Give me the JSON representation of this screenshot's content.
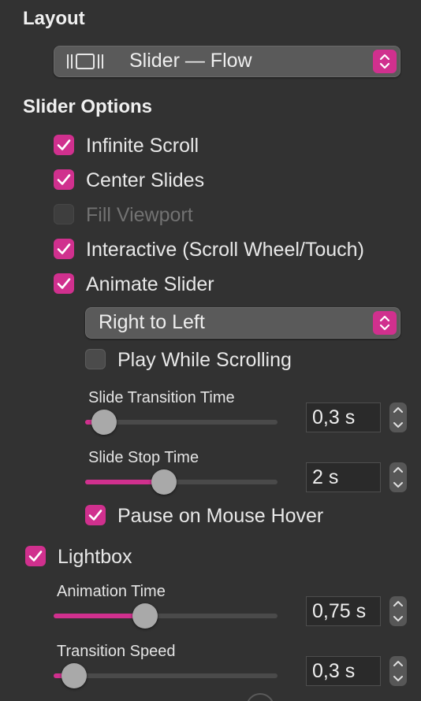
{
  "layout": {
    "title": "Layout",
    "select_value": "Slider — Flow",
    "select_icon": "slider-flow-icon"
  },
  "slider_options": {
    "title": "Slider Options",
    "infinite_scroll": {
      "label": "Infinite Scroll",
      "checked": true
    },
    "center_slides": {
      "label": "Center Slides",
      "checked": true
    },
    "fill_viewport": {
      "label": "Fill Viewport",
      "checked": false,
      "enabled": false
    },
    "interactive": {
      "label": "Interactive (Scroll Wheel/Touch)",
      "checked": true
    },
    "animate_slider": {
      "label": "Animate Slider",
      "checked": true
    },
    "direction_select": "Right to Left",
    "play_while_scrolling": {
      "label": "Play While Scrolling",
      "checked": false
    },
    "slide_transition_time": {
      "label": "Slide Transition Time",
      "value": "0,3 s",
      "level": 0.1
    },
    "slide_stop_time": {
      "label": "Slide Stop Time",
      "value": "2 s",
      "level": 0.41
    },
    "pause_on_hover": {
      "label": "Pause on Mouse Hover",
      "checked": true
    }
  },
  "lightbox": {
    "label": "Lightbox",
    "checked": true,
    "animation_time": {
      "label": "Animation Time",
      "value": "0,75 s",
      "level": 0.41
    },
    "transition_speed": {
      "label": "Transition Speed",
      "value": "0,3 s",
      "level": 0.09
    }
  },
  "colors": {
    "accent": "#d0308e",
    "background": "#323232"
  }
}
